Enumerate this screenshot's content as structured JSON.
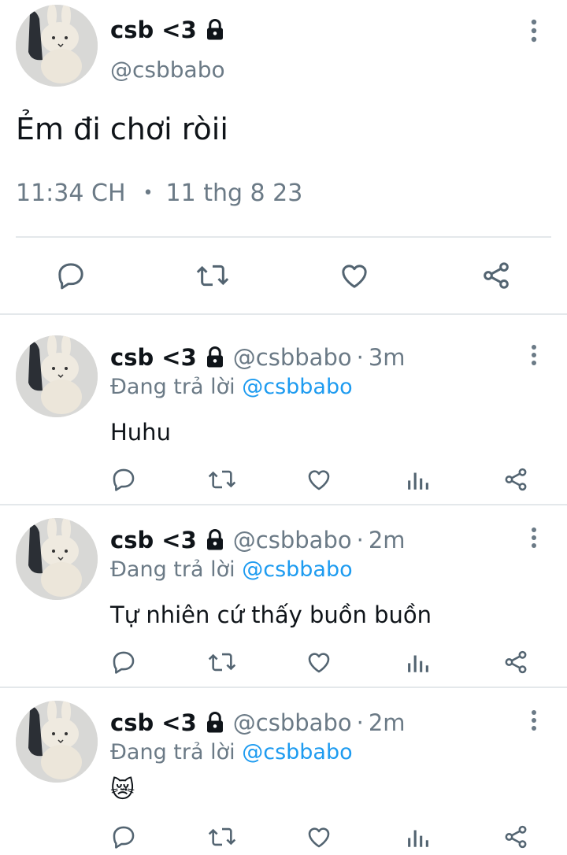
{
  "main_tweet": {
    "display_name": "csb <3",
    "handle": "@csbbabo",
    "text": "Ẻm đi chơi ròii",
    "time": "11:34 CH",
    "separator": "•",
    "date": "11 thg 8 23",
    "icons": [
      "more-vertical-icon",
      "reply-icon",
      "retweet-icon",
      "like-icon",
      "share-icon",
      "lock-icon"
    ]
  },
  "replies": [
    {
      "display_name": "csb <3",
      "handle": "@csbbabo",
      "time_sep": "·",
      "age": "3m",
      "replying_to_prefix": "Đang trả lời",
      "replying_to_handle": "@csbbabo",
      "text": "Huhu"
    },
    {
      "display_name": "csb <3",
      "handle": "@csbbabo",
      "time_sep": "·",
      "age": "2m",
      "replying_to_prefix": "Đang trả lời",
      "replying_to_handle": "@csbbabo",
      "text": "Tự nhiên cứ thấy buồn buồn"
    },
    {
      "display_name": "csb <3",
      "handle": "@csbbabo",
      "time_sep": "·",
      "age": "2m",
      "replying_to_prefix": "Đang trả lời",
      "replying_to_handle": "@csbbabo",
      "text": "😿"
    }
  ],
  "reply_icons": [
    "reply-icon",
    "retweet-icon",
    "like-icon",
    "analytics-icon",
    "share-icon"
  ],
  "colors": {
    "text": "#0f1419",
    "secondary": "#6b7a86",
    "link": "#1d9bf0",
    "divider": "#e4e8eb"
  }
}
